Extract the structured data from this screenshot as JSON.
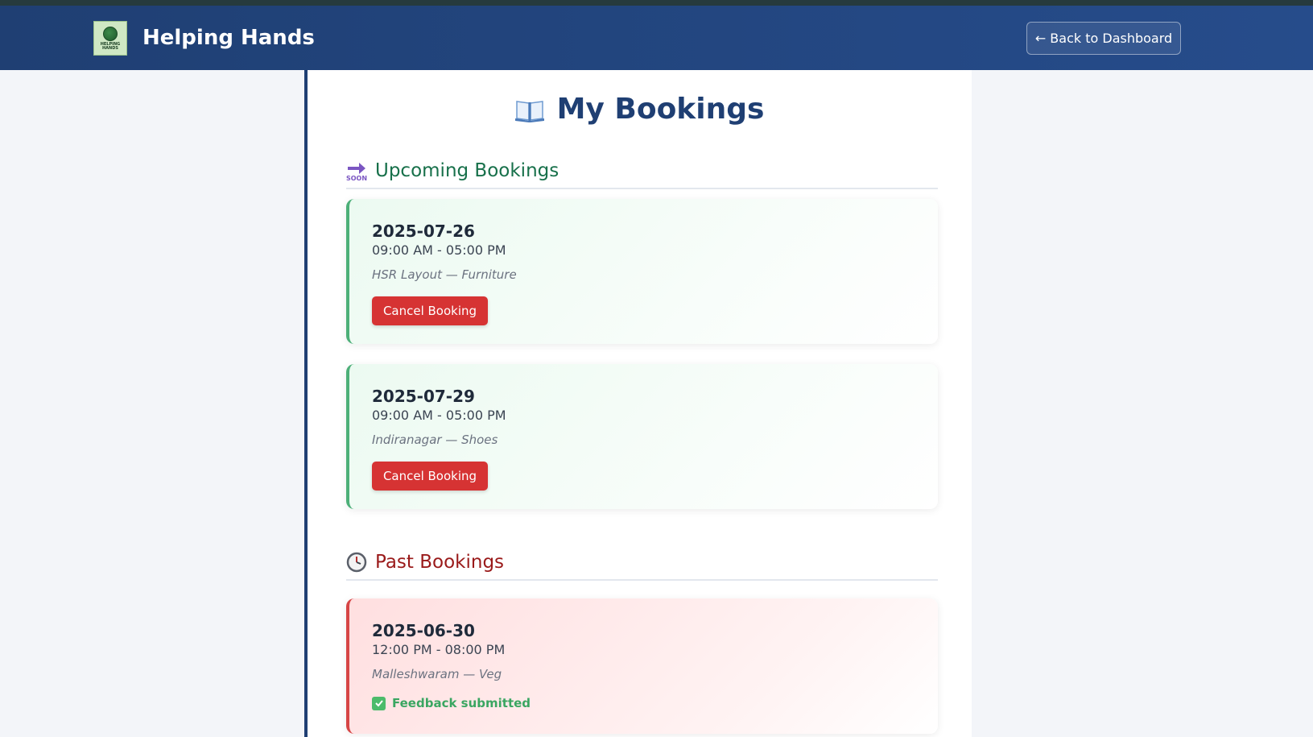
{
  "app": {
    "brand": "Helping Hands",
    "logo_text": "HELPING HANDS",
    "back_label": "← Back to Dashboard"
  },
  "page": {
    "title": "My Bookings",
    "title_icon": "open-book-icon"
  },
  "upcoming": {
    "heading": "Upcoming Bookings",
    "icon": "soon-arrow-icon",
    "icon_text": "SOON",
    "bookings": [
      {
        "date": "2025-07-26",
        "time": "09:00 AM - 05:00 PM",
        "location": "HSR Layout — Furniture",
        "action": "Cancel Booking"
      },
      {
        "date": "2025-07-29",
        "time": "09:00 AM - 05:00 PM",
        "location": "Indiranagar — Shoes",
        "action": "Cancel Booking"
      }
    ]
  },
  "past": {
    "heading": "Past Bookings",
    "icon": "clock-icon",
    "bookings": [
      {
        "date": "2025-06-30",
        "time": "12:00 PM - 08:00 PM",
        "location": "Malleshwaram — Veg",
        "status": "Feedback submitted"
      }
    ]
  },
  "colors": {
    "navbar": "#264c8b",
    "upcoming_accent": "#4caf78",
    "past_accent": "#d64545",
    "cancel_button": "#d63333",
    "feedback_green": "#3aa661"
  }
}
